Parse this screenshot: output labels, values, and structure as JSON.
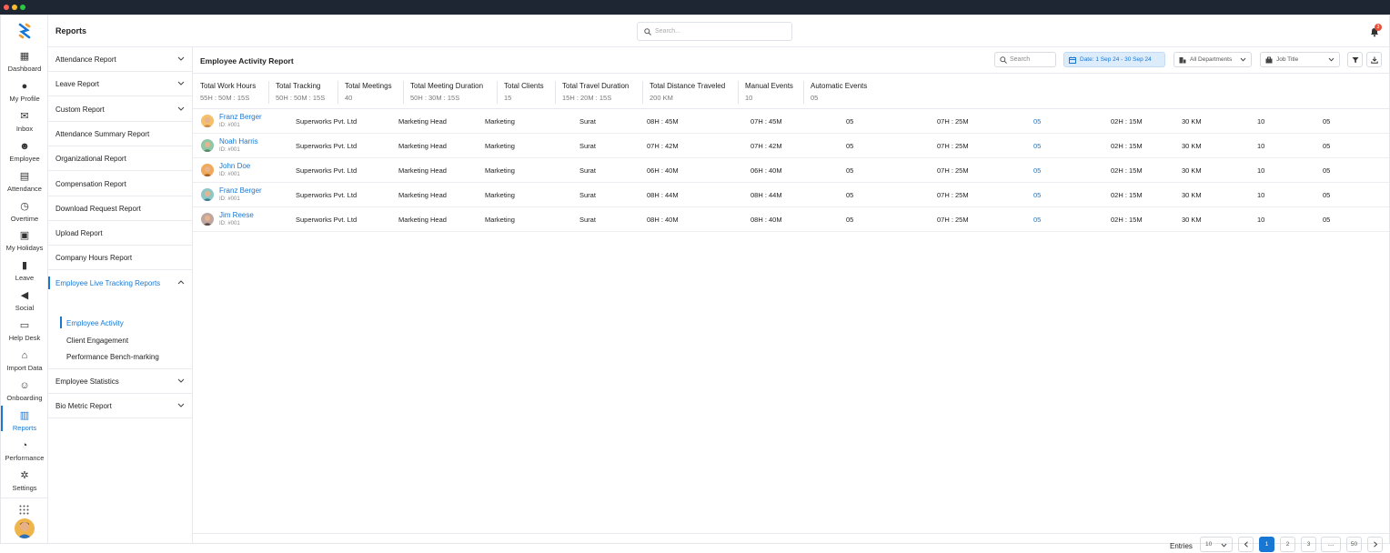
{
  "header": {
    "title": "Reports",
    "search_placeholder": "Search...",
    "notification_count": "3"
  },
  "rail": {
    "items": [
      {
        "label": "Dashboard",
        "icon": "dashboard-icon"
      },
      {
        "label": "My Profile",
        "icon": "user-icon"
      },
      {
        "label": "Inbox",
        "icon": "inbox-icon"
      },
      {
        "label": "Employee",
        "icon": "employee-icon"
      },
      {
        "label": "Attendance",
        "icon": "calendar-icon"
      },
      {
        "label": "Overtime",
        "icon": "overtime-icon"
      },
      {
        "label": "My Holidays",
        "icon": "holiday-icon"
      },
      {
        "label": "Leave",
        "icon": "leave-icon"
      },
      {
        "label": "Social",
        "icon": "megaphone-icon"
      },
      {
        "label": "Help Desk",
        "icon": "ticket-icon"
      },
      {
        "label": "Import Data",
        "icon": "import-icon"
      },
      {
        "label": "Onboarding",
        "icon": "onboarding-icon"
      },
      {
        "label": "Reports",
        "icon": "reports-icon"
      },
      {
        "label": "Performance",
        "icon": "performance-icon"
      },
      {
        "label": "Settings",
        "icon": "gear-icon"
      }
    ],
    "active": "Reports"
  },
  "menu": {
    "items": [
      {
        "label": "Attendance Report",
        "chevron": "down"
      },
      {
        "label": "Leave Report",
        "chevron": "down"
      },
      {
        "label": "Custom Report",
        "chevron": "down"
      },
      {
        "label": "Attendance Summary Report"
      },
      {
        "label": "Organizational Report"
      },
      {
        "label": "Compensation Report"
      },
      {
        "label": "Download Request Report"
      },
      {
        "label": "Upload Report"
      },
      {
        "label": "Company Hours Report"
      },
      {
        "label": "Employee Live Tracking Reports",
        "chevron": "up"
      }
    ],
    "subitems": [
      {
        "label": "Employee Activity"
      },
      {
        "label": "Client Engagement"
      },
      {
        "label": "Performance Bench-marking"
      }
    ],
    "after": [
      {
        "label": "Employee Statistics",
        "chevron": "down"
      },
      {
        "label": "Bio Metric Report",
        "chevron": "down"
      }
    ]
  },
  "toolbar": {
    "title": "Employee Activity Report",
    "search_placeholder": "Search",
    "date_label": "Date: 1 Sep 24 - 30 Sep 24",
    "department": "All Departments",
    "job_title": "Job Title"
  },
  "stats": [
    {
      "label": "Total Work Hours",
      "value": "55H : 50M : 15S"
    },
    {
      "label": "Total Tracking",
      "value": "50H : 50M : 15S"
    },
    {
      "label": "Total Meetings",
      "value": "40"
    },
    {
      "label": "Total Meeting Duration",
      "value": "50H : 30M : 15S"
    },
    {
      "label": "Total Clients",
      "value": "15"
    },
    {
      "label": "Total Travel Duration",
      "value": "15H : 20M : 15S"
    },
    {
      "label": "Total Distance Traveled",
      "value": "200 KM"
    },
    {
      "label": "Manual Events",
      "value": "10"
    },
    {
      "label": "Automatic Events",
      "value": "05"
    }
  ],
  "rows": [
    {
      "name": "Franz Berger",
      "id": "ID: #001",
      "company": "Superworks Pvt. Ltd",
      "role": "Marketing Head",
      "dept": "Marketing",
      "city": "Surat",
      "work": "08H : 45M",
      "tracking": "07H : 45M",
      "meetings": "05",
      "meeting_dur": "07H : 25M",
      "clients": "05",
      "travel": "02H : 15M",
      "distance": "30 KM",
      "manual": "10",
      "auto": "05"
    },
    {
      "name": "Noah Harris",
      "id": "ID: #001",
      "company": "Superworks Pvt. Ltd",
      "role": "Marketing Head",
      "dept": "Marketing",
      "city": "Surat",
      "work": "07H : 42M",
      "tracking": "07H : 42M",
      "meetings": "05",
      "meeting_dur": "07H : 25M",
      "clients": "05",
      "travel": "02H : 15M",
      "distance": "30 KM",
      "manual": "10",
      "auto": "05"
    },
    {
      "name": "John Doe",
      "id": "ID: #001",
      "company": "Superworks Pvt. Ltd",
      "role": "Marketing Head",
      "dept": "Marketing",
      "city": "Surat",
      "work": "06H : 40M",
      "tracking": "06H : 40M",
      "meetings": "05",
      "meeting_dur": "07H : 25M",
      "clients": "05",
      "travel": "02H : 15M",
      "distance": "30 KM",
      "manual": "10",
      "auto": "05"
    },
    {
      "name": "Franz Berger",
      "id": "ID: #001",
      "company": "Superworks Pvt. Ltd",
      "role": "Marketing Head",
      "dept": "Marketing",
      "city": "Surat",
      "work": "08H : 44M",
      "tracking": "08H : 44M",
      "meetings": "05",
      "meeting_dur": "07H : 25M",
      "clients": "05",
      "travel": "02H : 15M",
      "distance": "30 KM",
      "manual": "10",
      "auto": "05"
    },
    {
      "name": "Jim Reese",
      "id": "ID: #001",
      "company": "Superworks Pvt. Ltd",
      "role": "Marketing Head",
      "dept": "Marketing",
      "city": "Surat",
      "work": "08H : 40M",
      "tracking": "08H : 40M",
      "meetings": "05",
      "meeting_dur": "07H : 25M",
      "clients": "05",
      "travel": "02H : 15M",
      "distance": "30 KM",
      "manual": "10",
      "auto": "05"
    }
  ],
  "pagination": {
    "entries_label": "Entries",
    "entries_value": "10",
    "pages": [
      "1",
      "2",
      "3",
      "....",
      "50"
    ],
    "current": "1"
  },
  "colors": {
    "accent": "#1877d2",
    "badge": "#e8503a",
    "date_bg": "#dcecfb"
  }
}
